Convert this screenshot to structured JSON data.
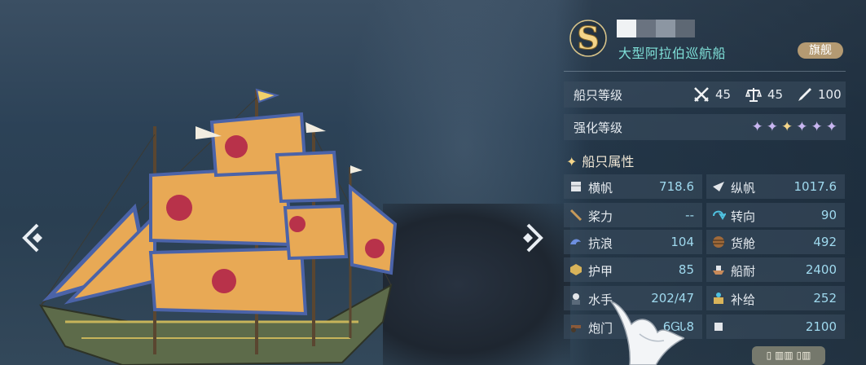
{
  "ship": {
    "grade": "S",
    "type_name": "大型阿拉伯巡航船",
    "flagship_badge": "旗舰"
  },
  "ship_level": {
    "label": "船只等级",
    "values": [
      {
        "icon": "crossed-swords-icon",
        "value": "45"
      },
      {
        "icon": "balance-scale-icon",
        "value": "45"
      },
      {
        "icon": "quill-pen-icon",
        "value": "100"
      }
    ]
  },
  "enhance_level": {
    "label": "强化等级",
    "stars_total": 6,
    "stars_filled": 6,
    "star_colors": [
      "#c8b6f0",
      "#c8b6f0",
      "#f4d58a",
      "#c8b6f0",
      "#c8b6f0",
      "#c8b6f0"
    ]
  },
  "attributes": {
    "title": "船只属性",
    "left": [
      {
        "icon": "square-sail-icon",
        "label": "横帆",
        "value": "718.6"
      },
      {
        "icon": "oar-icon",
        "label": "桨力",
        "value": "--"
      },
      {
        "icon": "wave-icon",
        "label": "抗浪",
        "value": "104"
      },
      {
        "icon": "armor-icon",
        "label": "护甲",
        "value": "85"
      },
      {
        "icon": "sailor-icon",
        "label": "水手",
        "value": "202/47"
      },
      {
        "icon": "cannon-icon",
        "label": "炮门",
        "value": "6ᏀᏓ8"
      }
    ],
    "right": [
      {
        "icon": "lateen-sail-icon",
        "label": "纵帆",
        "value": "1017.6"
      },
      {
        "icon": "turn-arrow-icon",
        "label": "转向",
        "value": "90"
      },
      {
        "icon": "cargo-barrel-icon",
        "label": "货舱",
        "value": "492"
      },
      {
        "icon": "hull-icon",
        "label": "船耐",
        "value": "2400"
      },
      {
        "icon": "supply-icon",
        "label": "补给",
        "value": "252"
      },
      {
        "icon": "misc-icon",
        "label": "",
        "value": "2100"
      }
    ]
  },
  "bottom_button": {
    "label": "▯ ▥▥ ▯▥"
  },
  "colors": {
    "accent_teal": "#7fe0d8",
    "value_blue": "#9fd9ee",
    "badge_gold": "#b49a72",
    "sail_orange": "#e8a955",
    "sail_blue": "#4b63a8"
  }
}
